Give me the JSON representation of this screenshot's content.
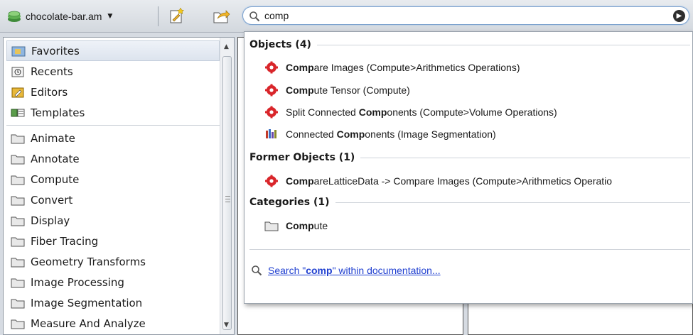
{
  "toolbar": {
    "project_label": "chocolate-bar.am",
    "search_value": "comp"
  },
  "sidebar": {
    "items_top": [
      {
        "label": "Favorites",
        "icon": "favorites-folder-icon",
        "selected": true
      },
      {
        "label": "Recents",
        "icon": "recents-icon"
      },
      {
        "label": "Editors",
        "icon": "editors-icon"
      },
      {
        "label": "Templates",
        "icon": "templates-icon"
      }
    ],
    "items_categories": [
      {
        "label": "Animate"
      },
      {
        "label": "Annotate"
      },
      {
        "label": "Compute"
      },
      {
        "label": "Convert"
      },
      {
        "label": "Display"
      },
      {
        "label": "Fiber Tracing"
      },
      {
        "label": "Geometry Transforms"
      },
      {
        "label": "Image Processing"
      },
      {
        "label": "Image Segmentation"
      },
      {
        "label": "Measure And Analyze"
      }
    ]
  },
  "popup": {
    "objects_header": "Objects (4)",
    "objects": [
      {
        "bold": "Comp",
        "rest": "are Images (Compute>Arithmetics Operations)",
        "icon": "red-gear-icon"
      },
      {
        "bold": "Comp",
        "rest": "ute Tensor (Compute)",
        "icon": "red-gear-icon"
      },
      {
        "pre": "Split Connected ",
        "bold": "Comp",
        "rest": "onents (Compute>Volume Operations)",
        "icon": "red-gear-icon"
      },
      {
        "pre": "Connected ",
        "bold": "Comp",
        "rest": "onents (Image Segmentation)",
        "icon": "segmentation-icon"
      }
    ],
    "former_header": "Former Objects (1)",
    "former": [
      {
        "bold": "Comp",
        "rest": "areLatticeData -> Compare Images (Compute>Arithmetics Operatio",
        "icon": "red-gear-icon"
      }
    ],
    "categories_header": "Categories (1)",
    "categories": [
      {
        "bold": "Comp",
        "rest": "ute",
        "icon": "folder-icon"
      }
    ],
    "doc_search": {
      "pre": "Search \"",
      "bold": "comp",
      "post": "\" within documentation..."
    }
  },
  "colors": {
    "accent_link": "#1f3fd0",
    "gear_red": "#d9252a"
  }
}
